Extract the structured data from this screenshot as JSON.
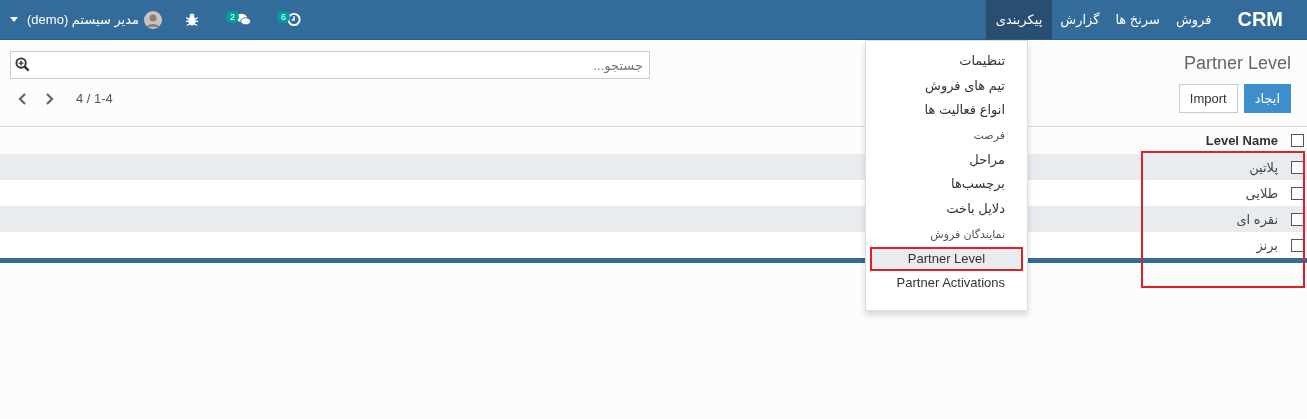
{
  "navbar": {
    "brand": "CRM",
    "menus": [
      {
        "label": "فروش",
        "selected": false
      },
      {
        "label": "سرنخ ها",
        "selected": false
      },
      {
        "label": "گزارش",
        "selected": false
      },
      {
        "label": "پیکربندی",
        "selected": true
      }
    ],
    "activities_badge": "6",
    "messages_badge": "2",
    "user": "مدیر سیستم (demo)"
  },
  "dropdown": {
    "items": [
      {
        "label": "تنظیمات",
        "selected": false,
        "kind": "normal",
        "annotated": false
      },
      {
        "label": "تیم های فروش",
        "selected": false,
        "kind": "normal",
        "annotated": false
      },
      {
        "label": "انواع فعالیت ها",
        "selected": false,
        "kind": "normal",
        "annotated": false
      },
      {
        "label": "فرصت",
        "selected": false,
        "kind": "header",
        "annotated": false
      },
      {
        "label": "مراحل",
        "selected": false,
        "kind": "normal",
        "annotated": false
      },
      {
        "label": "برچسب‌ها",
        "selected": false,
        "kind": "normal",
        "annotated": false
      },
      {
        "label": "دلایل باخت",
        "selected": false,
        "kind": "normal",
        "annotated": false
      },
      {
        "label": "نمایندگان فروش",
        "selected": false,
        "kind": "header",
        "annotated": false
      },
      {
        "label": "Partner Level",
        "selected": true,
        "kind": "normal",
        "annotated": true
      },
      {
        "label": "Partner Activations",
        "selected": false,
        "kind": "normal",
        "annotated": false
      }
    ]
  },
  "control_panel": {
    "title": "Partner Level",
    "buttons": [
      {
        "label": "ایجاد",
        "kind": "primary"
      },
      {
        "label": "Import",
        "kind": "secondary"
      }
    ],
    "search": {
      "placeholder": "جستجو..."
    },
    "pager": "4 / 1-4"
  },
  "table": {
    "column": "Level Name",
    "header_checked": false,
    "annotated": true,
    "rows": [
      {
        "name": "پلاتین",
        "checked": false
      },
      {
        "name": "طلایی",
        "checked": false
      },
      {
        "name": "نقره ای",
        "checked": false
      },
      {
        "name": "برنز",
        "checked": false
      }
    ]
  }
}
